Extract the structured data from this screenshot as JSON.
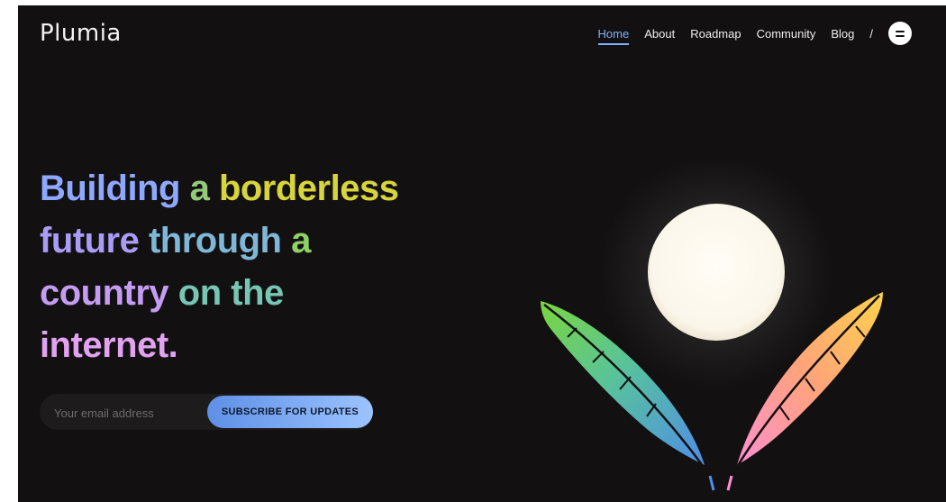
{
  "brand": {
    "name": "Plumia"
  },
  "nav": {
    "items": [
      {
        "label": "Home",
        "active": true
      },
      {
        "label": "About",
        "active": false
      },
      {
        "label": "Roadmap",
        "active": false
      },
      {
        "label": "Community",
        "active": false
      },
      {
        "label": "Blog",
        "active": false
      }
    ],
    "separator": "/",
    "menu_icon": "hamburger-menu-icon"
  },
  "hero": {
    "words": [
      {
        "text": "Building ",
        "color": "#8fa8ff"
      },
      {
        "text": "a ",
        "color": "#94c97a"
      },
      {
        "text": "borderless",
        "color": "#d8d53c"
      },
      {
        "text": "future ",
        "color": "#a99cf5"
      },
      {
        "text": "through ",
        "color": "#7fb7d6"
      },
      {
        "text": "a",
        "color": "#8ed164"
      },
      {
        "text": "country ",
        "color": "#c49cf2"
      },
      {
        "text": "on the",
        "color": "#76c6b3"
      },
      {
        "text": "internet.",
        "color": "#e1a2f0"
      }
    ]
  },
  "subscribe": {
    "placeholder": "Your email address",
    "button_label": "SUBSCRIBE FOR UPDATES"
  },
  "colors": {
    "background": "#121011",
    "accent": "#7fb2ff",
    "moon": "#fffaf0",
    "feather_left_top": "#7bd63f",
    "feather_left_bottom": "#4f8ee8",
    "feather_right_top": "#ffd24a",
    "feather_right_bottom": "#ff8fd0"
  }
}
